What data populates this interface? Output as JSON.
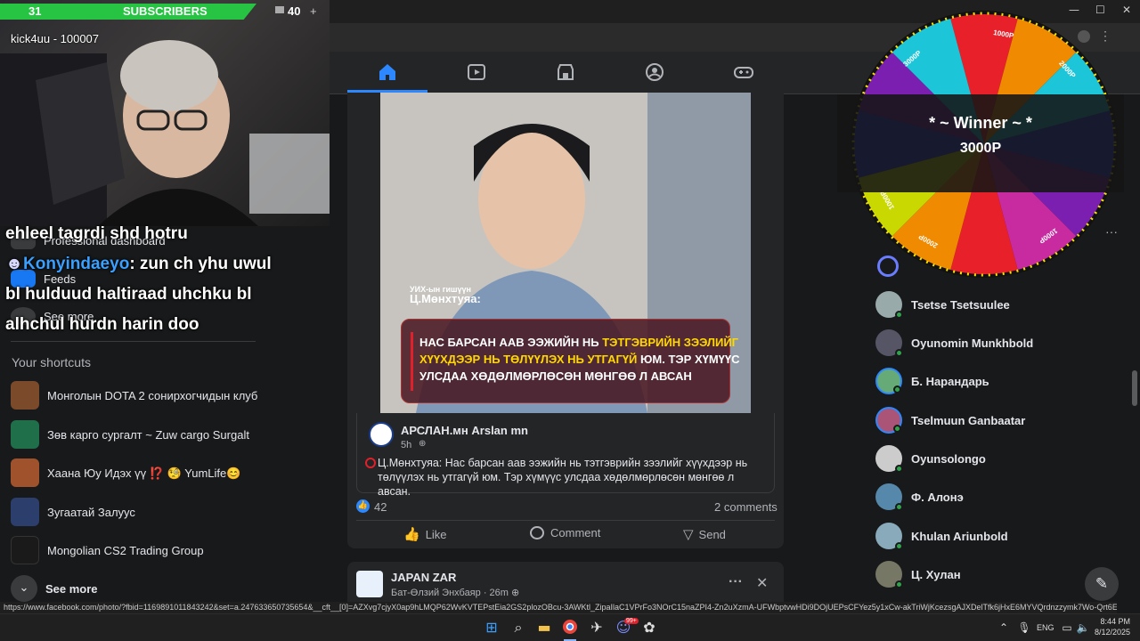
{
  "stream_overlay": {
    "subscribers_count": "31",
    "subscribers_label": "SUBSCRIBERS",
    "viewers_count": "40",
    "viewers_plus": "+",
    "donor_line": "kick4uu - 100007",
    "chat": [
      {
        "user": "",
        "text": "ehleel tagrdi shd hotru"
      },
      {
        "user": "Konyindaeyo",
        "text": " zun ch yhu uwul"
      },
      {
        "user": "",
        "text": "bl hulduud haltiraad uhchku bl"
      },
      {
        "user": "",
        "text": "alhchul hurdn harin doo"
      }
    ]
  },
  "left_sidebar": {
    "items": [
      {
        "label": "Professional dashboard",
        "icon": "dashboard-icon"
      },
      {
        "label": "Feeds",
        "icon": "feeds-icon"
      },
      {
        "label": "See more",
        "icon": "chevron-down-icon"
      }
    ],
    "shortcuts_title": "Your shortcuts",
    "shortcuts": [
      {
        "label": "Монголын DOTA 2 сонирхогчидын клуб",
        "color": "#7a4a2a"
      },
      {
        "label": "Зөв карго сургалт ~ Zuw cargo Surgalt",
        "color": "#1f6f4a"
      },
      {
        "label": "Хаана Юу Идэх үү ⁉️ 🧐 YumLife😊",
        "color": "#a0522d"
      },
      {
        "label": "Зугаатай Залуус",
        "color": "#2c3e6b"
      },
      {
        "label": "Mongolian CS2 Trading Group",
        "color": "#1a1a1a"
      }
    ],
    "see_more_label": "See more"
  },
  "nav": {
    "tabs": [
      {
        "name": "home",
        "glyph": "⌂"
      },
      {
        "name": "video",
        "glyph": "▶"
      },
      {
        "name": "marketplace",
        "glyph": "⌂"
      },
      {
        "name": "groups",
        "glyph": "☺"
      },
      {
        "name": "gaming",
        "glyph": "◎"
      }
    ]
  },
  "post": {
    "image_caption_top": "УИХ-ын гишүүн",
    "image_caption_name": "Ц.Мөнхтуяа:",
    "overlay_lines": [
      {
        "pre": "НАС БАРСАН ААВ ЭЭЖИЙН НЬ ",
        "hl": "ТЭТГЭВРИЙН ЗЭЭЛИЙГ",
        "post": ""
      },
      {
        "pre": "",
        "hl": "ХҮҮХДЭЭР НЬ ТӨЛҮҮЛЭХ НЬ УТГАГҮЙ",
        "post": " ЮМ. ТЭР ХҮМҮҮС"
      },
      {
        "pre": "УЛСДАА ХӨДӨЛМӨРЛӨСӨН МӨНГӨӨ Л АВСАН",
        "hl": "",
        "post": ""
      }
    ],
    "source_name": "АРСЛАН.мн Arslan mn",
    "source_time": "5h",
    "text": "Ц.Мөнхтуяа: Нас барсан аав ээжийн нь тэтгэврийн зээлийг хүүхдээр нь төлүүлэх нь утгагүй юм. Тэр хүмүүс улсдаа хөдөлмөрлөсөн мөнгөө л авсан.",
    "likes": "42",
    "comments": "2 comments",
    "actions": {
      "like": "Like",
      "comment": "Comment",
      "send": "Send"
    }
  },
  "post2": {
    "page_name": "JAPAN ZAR",
    "author": "Бат-Өлзий Энхбаяр",
    "time": "26m",
    "more": "···",
    "close": "✕"
  },
  "contacts": [
    {
      "name": "Tsetse Tsetsuulee",
      "color": "#9aa"
    },
    {
      "name": "Oyunomin Munkhbold",
      "color": "#556"
    },
    {
      "name": "Б. Нарандарь",
      "color": "#6a7"
    },
    {
      "name": "Tselmuun Ganbaatar",
      "color": "#a57"
    },
    {
      "name": "Oyunsolongo",
      "color": "#ccc"
    },
    {
      "name": "Ф. Алонэ",
      "color": "#58a"
    },
    {
      "name": "Khulan Ariunbold",
      "color": "#8ab"
    },
    {
      "name": "Ц. Хулан",
      "color": "#776"
    }
  ],
  "wheel": {
    "banner_title": "* ~ Winner ~ *",
    "banner_prize": "3000P",
    "segment_colors": [
      "#e8202a",
      "#f08a00",
      "#1cc6d8",
      "#2a44e8",
      "#7a1fb0",
      "#c82aa0",
      "#e8202a",
      "#f08a00",
      "#c8d800",
      "#2a44e8",
      "#7a1fb0",
      "#1cc6d8"
    ],
    "visible_labels": [
      "1000P",
      "2000P",
      "3000P",
      "1000P",
      "2000P",
      "1000P"
    ]
  },
  "status_url": "https://www.facebook.com/photo/?fbid=1169891011843242&set=a.247633650735654&__cft__[0]=AZXvg7cjyX0ap9hLMQP62WvKVTEPstEia2GS2plozOBcu-3AWKtl_ZipaIlaC1VPrFo3NOrC15naZPI4-Zn2uXzmA-UFWbptvwHDi9DOjUEPsCFYez5y1xCw-akTriWjKcezsgAJXDelTfk6jHxE6MYVQrdnzzymk7Wo-Qrt6EESV3MmDaw4J60h1mvmd8xkjpFeWaKIyoKJSYu...",
  "taskbar": {
    "lang": "ENG",
    "time": "8:44 PM",
    "date": "8/12/2025",
    "badge": "99+"
  }
}
